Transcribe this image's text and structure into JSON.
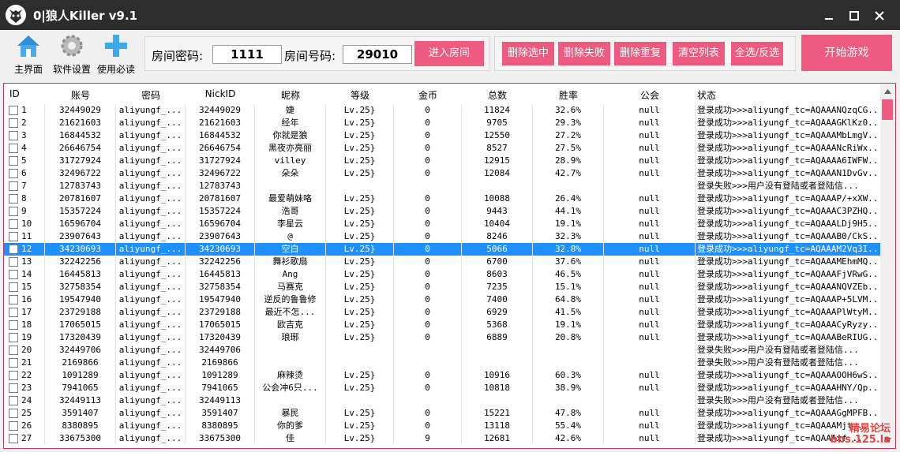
{
  "window": {
    "title": "0|狼人Killer v9.1",
    "minimize_icon": "minimize-icon",
    "maximize_icon": "maximize-icon",
    "close_icon": "close-icon"
  },
  "toolbar": {
    "home_label": "主界面",
    "settings_label": "软件设置",
    "help_label": "使用必读"
  },
  "room": {
    "password_label": "房间密码:",
    "password_value": "1111",
    "number_label": "房间号码:",
    "number_value": "29010",
    "enter_label": "进入房间"
  },
  "actions": {
    "delete_selected": "删除选中",
    "delete_failed": "删除失败",
    "delete_duplicates": "删除重复",
    "clear_list": "清空列表",
    "select_all": "全选/反选",
    "start_game": "开始游戏"
  },
  "colors": {
    "accent": "#ee5b80",
    "titlebar": "#2d2d2d",
    "selected_row": "#1e90ff"
  },
  "table": {
    "columns": [
      "ID",
      "账号",
      "密码",
      "NickID",
      "昵称",
      "等级",
      "金币",
      "总数",
      "胜率",
      "公会",
      "状态"
    ],
    "selected_index": 11,
    "rows": [
      [
        "1",
        "32449029",
        "aliyungf_...",
        "32449029",
        "婕",
        "Lv.25}",
        "0",
        "11824",
        "32.6%",
        "null",
        "登录成功>>>aliyungf_tc=AQAAANQzqCG..."
      ],
      [
        "2",
        "21621603",
        "aliyungf_...",
        "21621603",
        "经年",
        "Lv.25}",
        "0",
        "9705",
        "29.3%",
        "null",
        "登录成功>>>aliyungf_tc=AQAAAGKlKz0..."
      ],
      [
        "3",
        "16844532",
        "aliyungf_...",
        "16844532",
        "你就是狼",
        "Lv.25}",
        "0",
        "12550",
        "27.2%",
        "null",
        "登录成功>>>aliyungf_tc=AQAAAMbLmgV..."
      ],
      [
        "4",
        "26646754",
        "aliyungf_...",
        "26646754",
        "黑夜亦亮丽",
        "Lv.25}",
        "0",
        "8527",
        "27.5%",
        "null",
        "登录成功>>>aliyungf_tc=AQAAANcRiWx..."
      ],
      [
        "5",
        "31727924",
        "aliyungf_...",
        "31727924",
        "villey",
        "Lv.25}",
        "0",
        "12915",
        "28.9%",
        "null",
        "登录成功>>>aliyungf_tc=AQAAAA6IWFW..."
      ],
      [
        "6",
        "32496722",
        "aliyungf_...",
        "32496722",
        "朵朵",
        "Lv.25}",
        "0",
        "12084",
        "42.7%",
        "null",
        "登录成功>>>aliyungf_tc=AQAAAN1DvGv..."
      ],
      [
        "7",
        "12783743",
        "aliyungf_...",
        "12783743",
        "",
        "",
        "",
        "",
        "",
        "",
        "登录失败>>>用户没有登陆或者登陆信..."
      ],
      [
        "8",
        "20781607",
        "aliyungf_...",
        "20781607",
        "最爱萌妹咯",
        "Lv.25}",
        "0",
        "10088",
        "26.4%",
        "null",
        "登录成功>>>aliyungf_tc=AQAAAP/+xXW..."
      ],
      [
        "9",
        "15357224",
        "aliyungf_...",
        "15357224",
        "浩哥",
        "Lv.25}",
        "0",
        "9443",
        "44.1%",
        "null",
        "登录成功>>>aliyungf_tc=AQAAAC3PZHQ..."
      ],
      [
        "10",
        "16596704",
        "aliyungf_...",
        "16596704",
        "李星云",
        "Lv.25}",
        "0",
        "10404",
        "19.1%",
        "null",
        "登录成功>>>aliyungf_tc=AQAAALDj9H5..."
      ],
      [
        "11",
        "23907643",
        "aliyungf_...",
        "23907643",
        "@",
        "Lv.25}",
        "0",
        "8246",
        "32.3%",
        "null",
        "登录成功>>>aliyungf_tc=AQAAAB0/CkS..."
      ],
      [
        "12",
        "34230693",
        "aliyungf_...",
        "34230693",
        "空白",
        "Lv.25}",
        "0",
        "5066",
        "32.8%",
        "null",
        "登录成功>>>aliyungf_tc=AQAAAM2Vq3I..."
      ],
      [
        "13",
        "32242256",
        "aliyungf_...",
        "32242256",
        "舞衫歌扇",
        "Lv.25}",
        "0",
        "6700",
        "37.6%",
        "null",
        "登录成功>>>aliyungf_tc=AQAAAMEhmMQ..."
      ],
      [
        "14",
        "16445813",
        "aliyungf_...",
        "16445813",
        "Ang",
        "Lv.25}",
        "0",
        "8603",
        "46.5%",
        "null",
        "登录成功>>>aliyungf_tc=AQAAAFjVRwG..."
      ],
      [
        "15",
        "32758354",
        "aliyungf_...",
        "32758354",
        "马赛克",
        "Lv.25}",
        "0",
        "7235",
        "15.1%",
        "null",
        "登录成功>>>aliyungf_tc=AQAAANQVZEb..."
      ],
      [
        "16",
        "19547940",
        "aliyungf_...",
        "19547940",
        "逆反的鲁鲁修",
        "Lv.25}",
        "0",
        "7400",
        "64.8%",
        "null",
        "登录成功>>>aliyungf_tc=AQAAAP+5LVM..."
      ],
      [
        "17",
        "23729188",
        "aliyungf_...",
        "23729188",
        "最近不怎...",
        "Lv.25}",
        "0",
        "6929",
        "41.5%",
        "null",
        "登录成功>>>aliyungf_tc=AQAAAPlWtyM..."
      ],
      [
        "18",
        "17065015",
        "aliyungf_...",
        "17065015",
        "欧吉克",
        "Lv.25}",
        "0",
        "5368",
        "19.1%",
        "null",
        "登录成功>>>aliyungf_tc=AQAAACyRyzy..."
      ],
      [
        "19",
        "17320439",
        "aliyungf_...",
        "17320439",
        "琅琊",
        "Lv.25}",
        "0",
        "6889",
        "20.8%",
        "null",
        "登录成功>>>aliyungf_tc=AQAAABeRIUG..."
      ],
      [
        "20",
        "32449706",
        "aliyungf_...",
        "32449706",
        "",
        "",
        "",
        "",
        "",
        "",
        "登录失败>>>用户没有登陆或者登陆信..."
      ],
      [
        "21",
        "2169866",
        "aliyungf_...",
        "2169866",
        "",
        "",
        "",
        "",
        "",
        "",
        "登录失败>>>用户没有登陆或者登陆信..."
      ],
      [
        "22",
        "1091289",
        "aliyungf_...",
        "1091289",
        "麻辣烫",
        "Lv.25}",
        "0",
        "10916",
        "60.3%",
        "null",
        "登录成功>>>aliyungf_tc=AQAAAOOH6wS..."
      ],
      [
        "23",
        "7941065",
        "aliyungf_...",
        "7941065",
        "公会冲6只...",
        "Lv.25}",
        "0",
        "10818",
        "38.9%",
        "null",
        "登录成功>>>aliyungf_tc=AQAAAHNY/Qp..."
      ],
      [
        "24",
        "32449113",
        "aliyungf_...",
        "32449113",
        "",
        "",
        "",
        "",
        "",
        "",
        "登录失败>>>用户没有登陆或者登陆信..."
      ],
      [
        "25",
        "3591407",
        "aliyungf_...",
        "3591407",
        "暴民",
        "Lv.25}",
        "0",
        "15221",
        "47.8%",
        "null",
        "登录成功>>>aliyungf_tc=AQAAAGgMPFB..."
      ],
      [
        "26",
        "8380895",
        "aliyungf_...",
        "8380895",
        "你的爹",
        "Lv.25}",
        "0",
        "13118",
        "55.4%",
        "null",
        "登录成功>>>aliyungf_tc=AQAAAMjt..."
      ],
      [
        "27",
        "33675300",
        "aliyungf_...",
        "33675300",
        "佳",
        "Lv.25}",
        "9",
        "12681",
        "42.6%",
        "null",
        "登录成功>>>aliyungf_tc=AQAAAxf..."
      ]
    ]
  },
  "watermark": {
    "line1": "精易论坛",
    "line2": "bbs.125.la"
  }
}
